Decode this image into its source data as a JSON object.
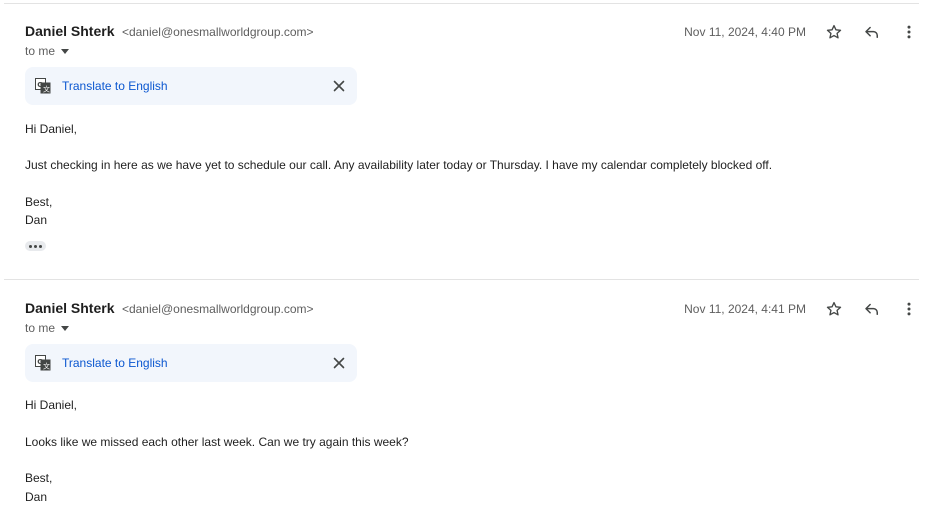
{
  "messages": [
    {
      "sender_name": "Daniel Shterk",
      "sender_email": "<daniel@onesmallworldgroup.com>",
      "recipient": "to me",
      "timestamp": "Nov 11, 2024, 4:40 PM",
      "translate_label": "Translate to English",
      "greeting": "Hi Daniel,",
      "body": "Just checking in here as we have yet to schedule our call. Any availability later today or Thursday. I have my calendar completely blocked off.",
      "signoff": "Best,",
      "signature": "Dan"
    },
    {
      "sender_name": "Daniel Shterk",
      "sender_email": "<daniel@onesmallworldgroup.com>",
      "recipient": "to me",
      "timestamp": "Nov 11, 2024, 4:41 PM",
      "translate_label": "Translate to English",
      "greeting": "Hi Daniel,",
      "body": "Looks like we missed each other last week. Can we try again this week?",
      "signoff": "Best,",
      "signature": "Dan"
    }
  ],
  "icons": {
    "star": "star-icon",
    "reply": "reply-icon",
    "more": "more-vert-icon",
    "translate": "translate-icon",
    "close": "close-icon",
    "expand": "ellipsis-icon",
    "caret": "caret-down-icon"
  },
  "colors": {
    "link": "#0b57d0",
    "translate_bar_bg": "#f2f6fc",
    "secondary_text": "#5e5e5e",
    "divider": "#e3e3e3"
  }
}
